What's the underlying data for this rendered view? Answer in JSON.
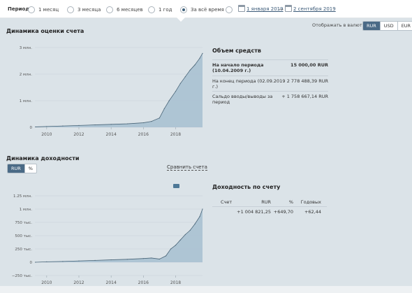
{
  "period": {
    "label": "Период:",
    "options": [
      {
        "label": "1 месяц",
        "selected": false
      },
      {
        "label": "3 месяца",
        "selected": false
      },
      {
        "label": "6 месяцев",
        "selected": false
      },
      {
        "label": "1 год",
        "selected": false
      },
      {
        "label": "За всё время",
        "selected": true
      }
    ],
    "date_from": "1 января 2019",
    "date_separator": "—",
    "date_to": "2 сентября 2019"
  },
  "valuation": {
    "title": "Динамика оценки счета",
    "currency_label": "Отображать в валюте:",
    "currencies": [
      "RUR",
      "USD",
      "EUR"
    ],
    "active_currency": "RUR",
    "chart_ticks_y": [
      "0",
      "1 млн.",
      "2 млн.",
      "3 млн."
    ],
    "chart_ticks_x": [
      "2010",
      "2012",
      "2014",
      "2016",
      "2018"
    ]
  },
  "assets": {
    "title": "Объем средств",
    "rows": [
      {
        "key": "На начало периода (10.04.2009 г.)",
        "value": "15 000,00 RUR",
        "bold": true
      },
      {
        "key": "На конец периода (02.09.2019 г.)",
        "value": "2 778 488,39 RUR",
        "bold": false
      },
      {
        "key": "Сальдо вводы/выводы за период",
        "value": "+ 1 758 667,14 RUR",
        "bold": false
      }
    ]
  },
  "yield": {
    "title": "Динамика доходности",
    "modes": [
      "RUR",
      "%"
    ],
    "active_mode": "RUR",
    "compare_label": "Сравнить счета",
    "chart_ticks_y": [
      "−250 тыс.",
      "0",
      "250 тыс.",
      "500 тыс.",
      "750 тыс.",
      "1 млн.",
      "1.25 млн."
    ],
    "chart_ticks_x": [
      "2010",
      "2012",
      "2014",
      "2016",
      "2018"
    ]
  },
  "yield_table": {
    "title": "Доходность по счету",
    "headers": [
      "Счет",
      "RUR",
      "%",
      "Годовых"
    ],
    "row": [
      "",
      "+1 004 821,25",
      "+649,70",
      "+62,44"
    ]
  },
  "chart_data": [
    {
      "type": "area",
      "title": "Динамика оценки счета",
      "x_start": 2009.27,
      "x_end": 2019.67,
      "ylim": [
        0,
        3000000
      ],
      "x": [
        2009.3,
        2010,
        2011,
        2012,
        2013,
        2014,
        2015,
        2016,
        2016.5,
        2017,
        2017.3,
        2017.6,
        2018,
        2018.3,
        2018.6,
        2018.9,
        2019.2,
        2019.5,
        2019.67
      ],
      "values": [
        15000,
        30000,
        50000,
        70000,
        90000,
        110000,
        130000,
        170000,
        220000,
        350000,
        700000,
        1000000,
        1350000,
        1650000,
        1900000,
        2150000,
        2350000,
        2600000,
        2780000
      ]
    },
    {
      "type": "area",
      "title": "Динамика доходности",
      "x_start": 2009.27,
      "x_end": 2019.67,
      "ylim": [
        -250000,
        1250000
      ],
      "x": [
        2009.3,
        2010,
        2011,
        2012,
        2013,
        2014,
        2015,
        2016,
        2016.5,
        2017,
        2017.4,
        2017.7,
        2018,
        2018.3,
        2018.6,
        2018.9,
        2019.2,
        2019.5,
        2019.67
      ],
      "values": [
        0,
        8000,
        15000,
        25000,
        35000,
        45000,
        55000,
        70000,
        80000,
        60000,
        120000,
        250000,
        320000,
        420000,
        520000,
        600000,
        720000,
        860000,
        1000000
      ]
    }
  ]
}
